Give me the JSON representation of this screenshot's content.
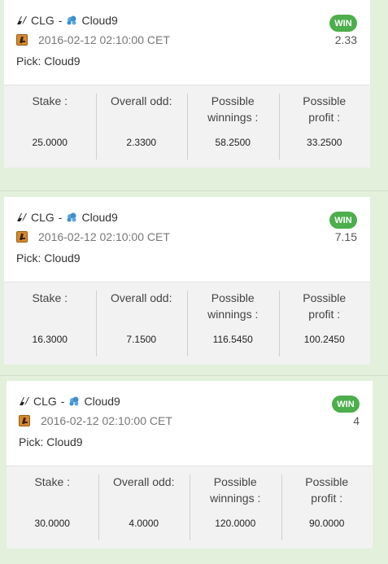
{
  "bets": [
    {
      "team1": "CLG",
      "separator": "-",
      "team2": "Cloud9",
      "date": "2016-02-12 02:10:00 CET",
      "pick": "Pick: Cloud9",
      "status": "WIN",
      "odd": "2.33",
      "stake_label": "Stake :",
      "overall_odd_label": "Overall odd:",
      "winnings_label": "Possible winnings :",
      "profit_label": "Possible profit :",
      "stake": "25.0000",
      "overall_odd": "2.3300",
      "winnings": "58.2500",
      "profit": "33.2500"
    },
    {
      "team1": "CLG",
      "separator": "-",
      "team2": "Cloud9",
      "date": "2016-02-12 02:10:00 CET",
      "pick": "Pick: Cloud9",
      "status": "WIN",
      "odd": "7.15",
      "stake_label": "Stake :",
      "overall_odd_label": "Overall odd:",
      "winnings_label": "Possible winnings :",
      "profit_label": "Possible profit :",
      "stake": "16.3000",
      "overall_odd": "7.1500",
      "winnings": "116.5450",
      "profit": "100.2450"
    },
    {
      "team1": "CLG",
      "separator": "-",
      "team2": "Cloud9",
      "date": "2016-02-12 02:10:00 CET",
      "pick": "Pick: Cloud9",
      "status": "WIN",
      "odd": "4",
      "stake_label": "Stake :",
      "overall_odd_label": "Overall odd:",
      "winnings_label": "Possible winnings :",
      "profit_label": "Possible profit :",
      "stake": "30.0000",
      "overall_odd": "4.0000",
      "winnings": "120.0000",
      "profit": "90.0000"
    }
  ],
  "colors": {
    "page_bg": "#e2f0dc",
    "win_badge": "#4cae4c",
    "stats_bg": "#f2f2f2"
  },
  "icons": {
    "team1": "clg-logo-icon",
    "team2": "cloud9-logo-icon",
    "game": "counter-strike-icon"
  }
}
